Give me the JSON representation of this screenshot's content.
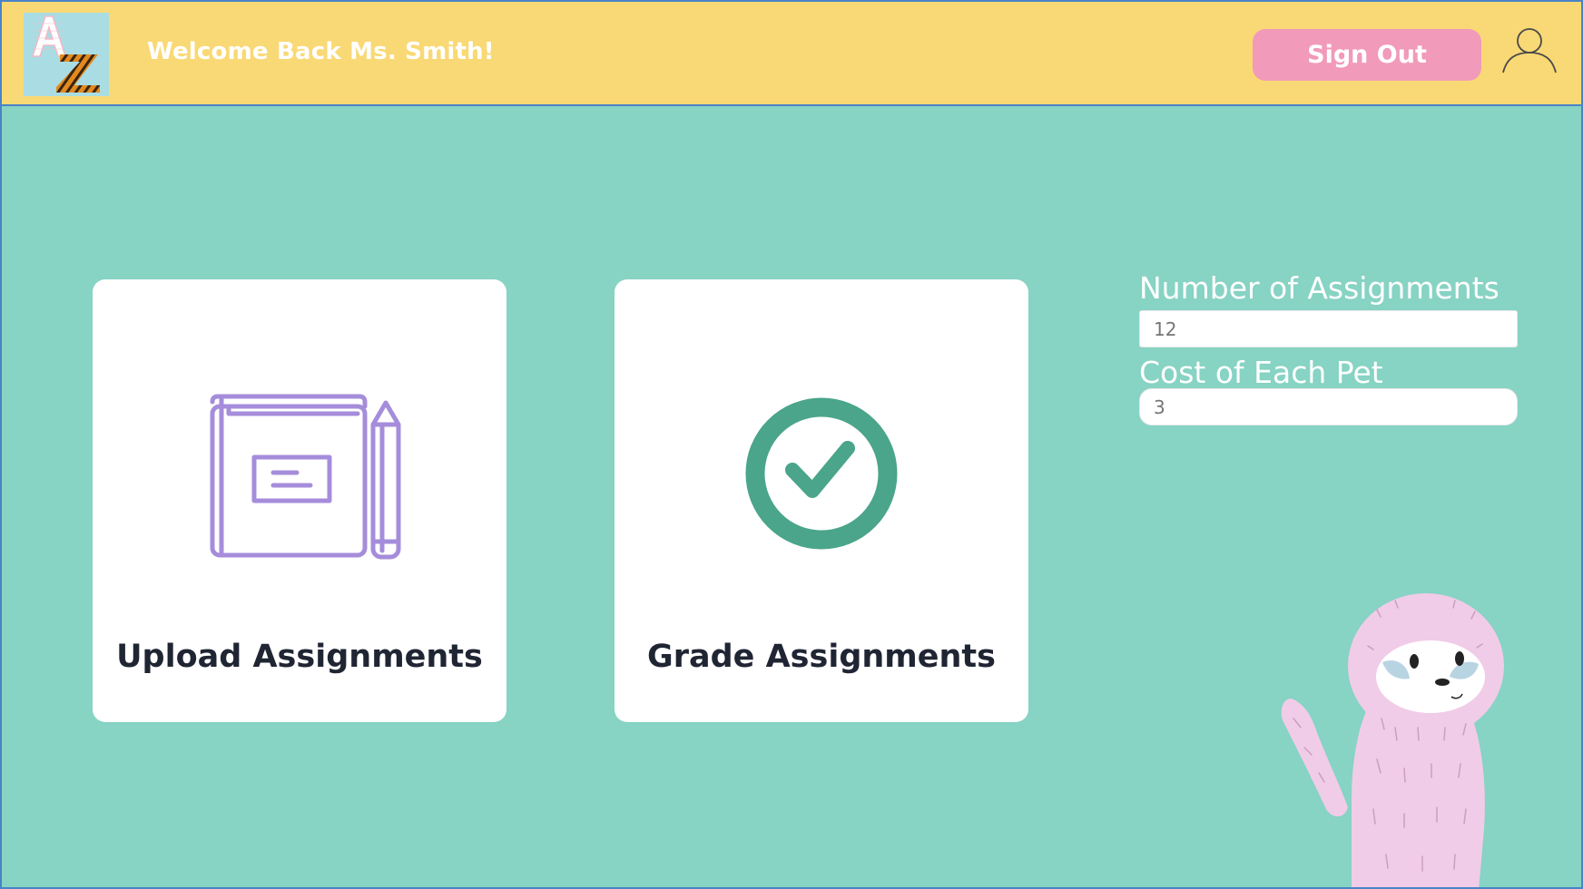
{
  "header": {
    "welcome": "Welcome Back Ms. Smith!",
    "sign_out_label": "Sign Out",
    "logo_letters": [
      "A",
      "Z"
    ]
  },
  "cards": {
    "upload": {
      "label": "Upload Assignments",
      "icon": "notebook-pencil-icon"
    },
    "grade": {
      "label": "Grade Assignments",
      "icon": "check-circle-icon"
    }
  },
  "settings": {
    "assignments": {
      "label": "Number of Assignments",
      "placeholder": "12"
    },
    "cost": {
      "label": "Cost of Each Pet",
      "placeholder": "3"
    }
  },
  "colors": {
    "background": "#87d3c4",
    "header": "#f9d975",
    "sign_out_button": "#f19ab9",
    "upload_icon": "#a58ddb",
    "grade_icon": "#4aa58a",
    "text_dark": "#1f2533",
    "sloth": "#f0cce8"
  }
}
